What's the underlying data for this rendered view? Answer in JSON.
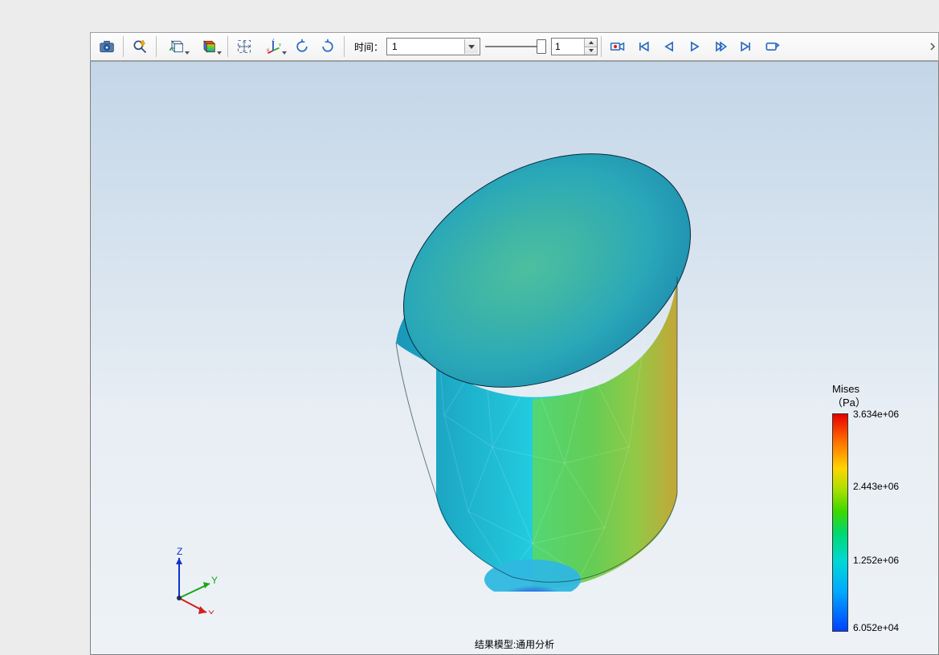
{
  "toolbar": {
    "time_label": "时间：",
    "time_value": "1",
    "frame_value": "1",
    "icons": {
      "camera": "camera-icon",
      "zoom_light": "zoom-lightning-icon",
      "box_brush": "box-brush-icon",
      "cube_color": "cube-colormap-icon",
      "fit": "fit-screen-icon",
      "axes": "axes-xyz-icon",
      "rotate_cw": "rotate-cw-icon",
      "rotate_ccw": "rotate-ccw-icon",
      "record": "record-icon",
      "first": "first-frame-icon",
      "prev": "prev-frame-icon",
      "play": "play-icon",
      "next": "next-frame-icon",
      "last": "last-frame-icon",
      "loop": "loop-icon",
      "overflow": "overflow-icon"
    }
  },
  "viewport": {
    "title": "结果模型:通用分析",
    "axes": {
      "x": "X",
      "y": "Y",
      "z": "Z"
    }
  },
  "legend": {
    "title": "Mises",
    "unit": "（Pa）",
    "ticks": [
      {
        "label": "3.634e+06",
        "pos": 0
      },
      {
        "label": "2.443e+06",
        "pos": 33
      },
      {
        "label": "1.252e+06",
        "pos": 67
      },
      {
        "label": "6.052e+04",
        "pos": 100
      }
    ]
  }
}
